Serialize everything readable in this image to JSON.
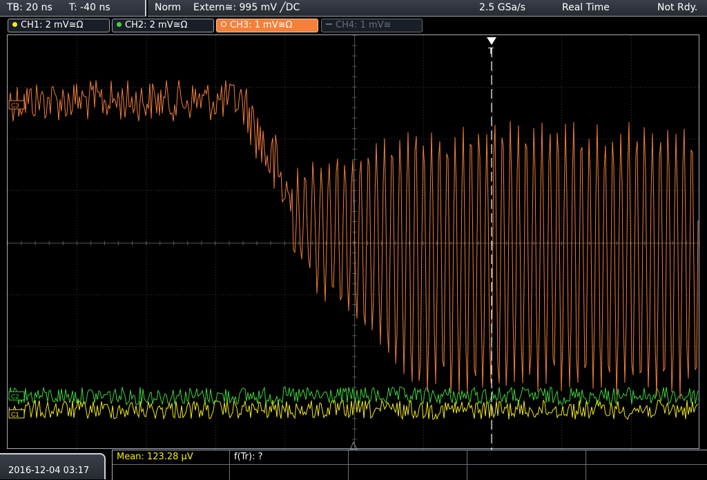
{
  "colors": {
    "ch1": "#f3ec16",
    "ch2": "#3fd63a",
    "ch3": "#f4803a",
    "ch4": "#6c6f75",
    "trigger_marker": "#ffffff",
    "grid": "#3b3f45"
  },
  "top_bar": {
    "timebase": "TB: 20 ns",
    "trigger_time": "T: -40 ns",
    "trigger_mode": "Norm",
    "trigger_source": "Extern≅: 995 mV ╱DC",
    "sample_rate": "2.5 GSa/s",
    "acq_mode": "Real Time",
    "status": "Not Rdy."
  },
  "channels": [
    {
      "label": "CH1: 2 mV≅Ω",
      "active": true
    },
    {
      "label": "CH2: 2 mV≅Ω",
      "active": true
    },
    {
      "label": "CH3: 1 mV≅Ω",
      "active": true,
      "selected": true
    },
    {
      "label": "CH4: 1 mV≅",
      "active": false
    }
  ],
  "waveform_markers": {
    "ch3": "C3",
    "ch2": "C2",
    "ch1": "C1",
    "trigger": "T"
  },
  "bottom_bar": {
    "datetime": "2016-12-04 03:17",
    "measurement_1": "Mean: 123.28 µV",
    "measurement_2": "f(Tr): ?"
  }
}
